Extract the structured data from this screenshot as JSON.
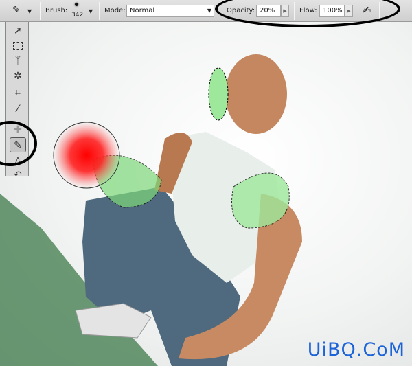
{
  "options_bar": {
    "tool_icon": "brush-icon",
    "brush_label": "Brush:",
    "brush_size": "342",
    "mode_label": "Mode:",
    "mode_value": "Normal",
    "opacity_label": "Opacity:",
    "opacity_value": "20%",
    "flow_label": "Flow:",
    "flow_value": "100%",
    "airbrush_icon": "airbrush-icon"
  },
  "toolbox": {
    "tools": [
      "move-tool",
      "marquee-tool",
      "lasso-tool",
      "magic-wand-tool",
      "crop-tool",
      "eyedropper-tool",
      "healing-tool",
      "brush-tool",
      "clone-stamp-tool",
      "history-brush-tool"
    ],
    "active": "brush-tool"
  },
  "colors": {
    "brush_preview": "#ff0000",
    "selection_glow": "#7de07d",
    "annotation": "#000000",
    "watermark": "#1d63d8"
  },
  "watermark": "UiBQ.CoM"
}
